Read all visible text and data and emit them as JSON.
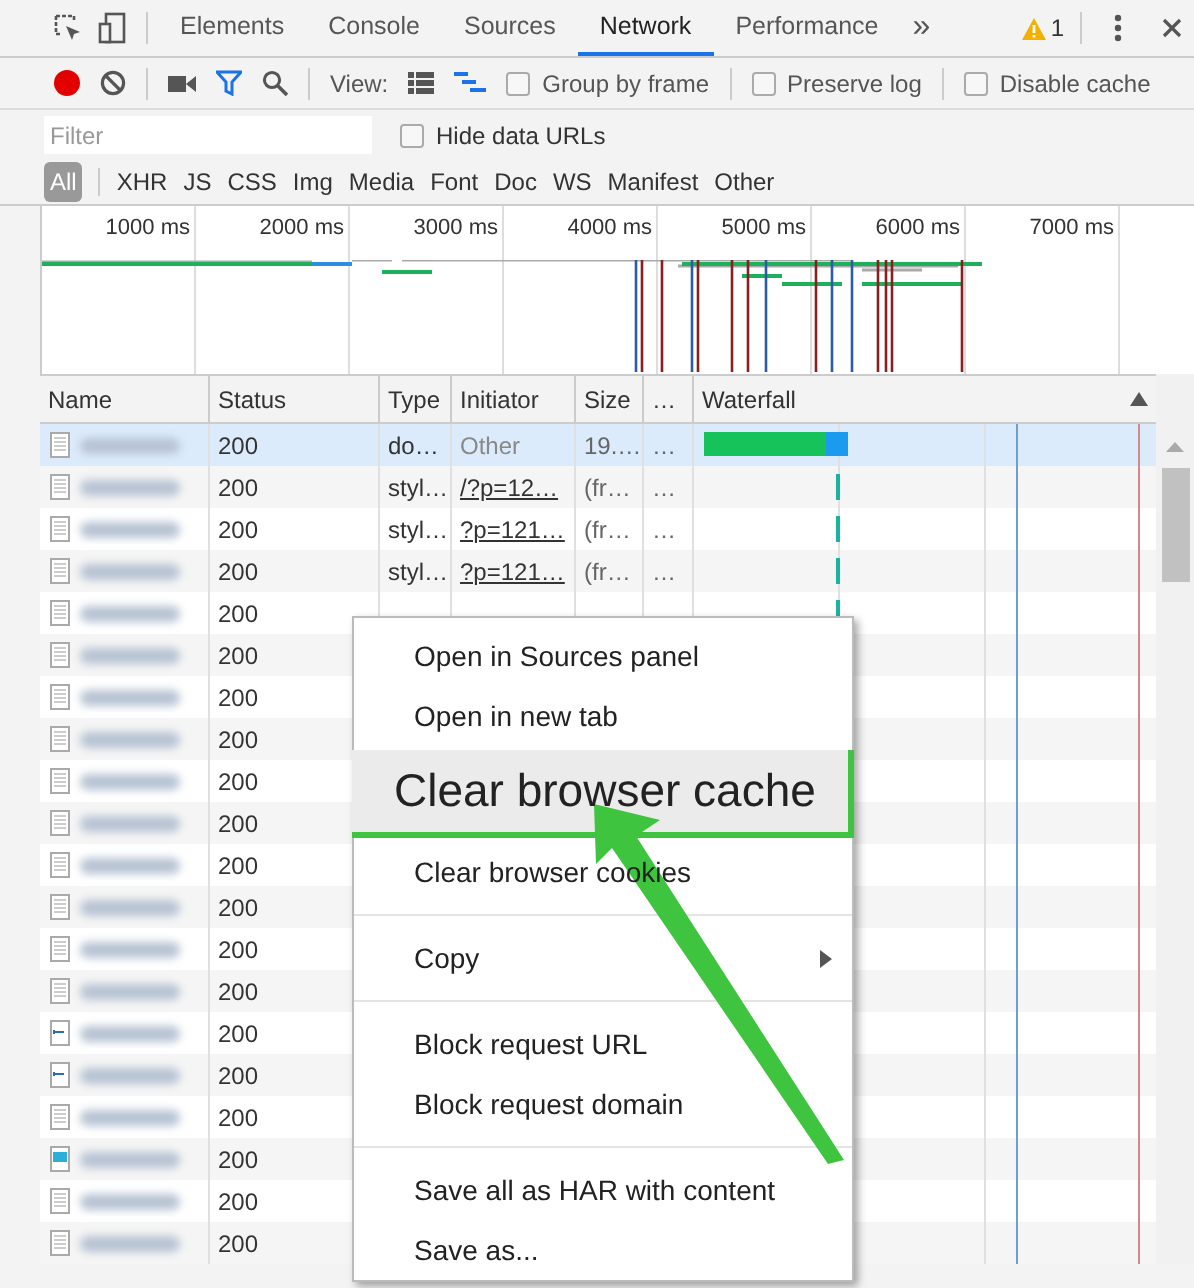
{
  "devtools_tabs": [
    {
      "label": "Elements",
      "selected": false
    },
    {
      "label": "Console",
      "selected": false
    },
    {
      "label": "Sources",
      "selected": false
    },
    {
      "label": "Network",
      "selected": true
    },
    {
      "label": "Performance",
      "selected": false
    }
  ],
  "more_tabs": "»",
  "warning_count": "1",
  "network_toolbar": {
    "recording": true,
    "filter_active": true,
    "view_label": "View:",
    "large_rows": false,
    "waterfall_view": true,
    "checkboxes": [
      {
        "label": "Group by frame",
        "checked": false
      },
      {
        "label": "Preserve log",
        "checked": false
      },
      {
        "label": "Disable cache",
        "checked": false
      }
    ]
  },
  "filter": {
    "placeholder": "Filter",
    "hide_data_urls": {
      "label": "Hide data URLs",
      "checked": false
    }
  },
  "type_filters": [
    {
      "label": "All",
      "selected": true
    },
    {
      "label": "XHR",
      "selected": false
    },
    {
      "label": "JS",
      "selected": false
    },
    {
      "label": "CSS",
      "selected": false
    },
    {
      "label": "Img",
      "selected": false
    },
    {
      "label": "Media",
      "selected": false
    },
    {
      "label": "Font",
      "selected": false
    },
    {
      "label": "Doc",
      "selected": false
    },
    {
      "label": "WS",
      "selected": false
    },
    {
      "label": "Manifest",
      "selected": false
    },
    {
      "label": "Other",
      "selected": false
    }
  ],
  "overview": {
    "ticks": [
      "1000 ms",
      "2000 ms",
      "3000 ms",
      "4000 ms",
      "5000 ms",
      "6000 ms",
      "7000 ms"
    ]
  },
  "table": {
    "columns": [
      "Name",
      "Status",
      "Type",
      "Initiator",
      "Size",
      "…",
      "Waterfall"
    ],
    "rows": [
      {
        "kind": "document",
        "status": "200",
        "type": "do…",
        "initiator": "Other",
        "size": "19.…",
        "more": "…",
        "selected": true
      },
      {
        "kind": "document",
        "status": "200",
        "type": "styl…",
        "initiator": "/?p=12…",
        "size": "(fr…",
        "more": "…",
        "selected": false
      },
      {
        "kind": "document",
        "status": "200",
        "type": "styl…",
        "initiator": "?p=121…",
        "size": "(fr…",
        "more": "…",
        "selected": false
      },
      {
        "kind": "document",
        "status": "200",
        "type": "styl…",
        "initiator": "?p=121…",
        "size": "(fr…",
        "more": "…",
        "selected": false
      },
      {
        "kind": "document",
        "status": "200",
        "selected": false
      },
      {
        "kind": "document",
        "status": "200",
        "selected": false
      },
      {
        "kind": "document",
        "status": "200",
        "selected": false
      },
      {
        "kind": "document",
        "status": "200",
        "selected": false
      },
      {
        "kind": "document",
        "status": "200",
        "selected": false
      },
      {
        "kind": "document",
        "status": "200",
        "selected": false
      },
      {
        "kind": "document",
        "status": "200",
        "selected": false
      },
      {
        "kind": "document",
        "status": "200",
        "selected": false
      },
      {
        "kind": "document",
        "status": "200",
        "selected": false
      },
      {
        "kind": "document",
        "status": "200",
        "selected": false
      },
      {
        "kind": "script",
        "status": "200",
        "selected": false
      },
      {
        "kind": "script",
        "status": "200",
        "selected": false
      },
      {
        "kind": "document",
        "status": "200",
        "selected": false
      },
      {
        "kind": "image",
        "status": "200",
        "selected": false
      },
      {
        "kind": "document",
        "status": "200",
        "selected": false
      },
      {
        "kind": "document",
        "status": "200",
        "selected": false
      }
    ]
  },
  "context_menu": {
    "groups": [
      [
        {
          "label": "Open in Sources panel",
          "highlighted": false,
          "submenu": false
        },
        {
          "label": "Open in new tab",
          "highlighted": false,
          "submenu": false
        },
        {
          "label": "Clear browser cache",
          "highlighted": true,
          "submenu": false
        },
        {
          "label": "Clear browser cookies",
          "highlighted": false,
          "submenu": false
        }
      ],
      [
        {
          "label": "Copy",
          "highlighted": false,
          "submenu": true
        }
      ],
      [
        {
          "label": "Block request URL",
          "highlighted": false,
          "submenu": false
        },
        {
          "label": "Block request domain",
          "highlighted": false,
          "submenu": false
        }
      ],
      [
        {
          "label": "Save all as HAR with content",
          "highlighted": false,
          "submenu": false
        },
        {
          "label": "Save as...",
          "highlighted": false,
          "submenu": false
        }
      ]
    ]
  }
}
